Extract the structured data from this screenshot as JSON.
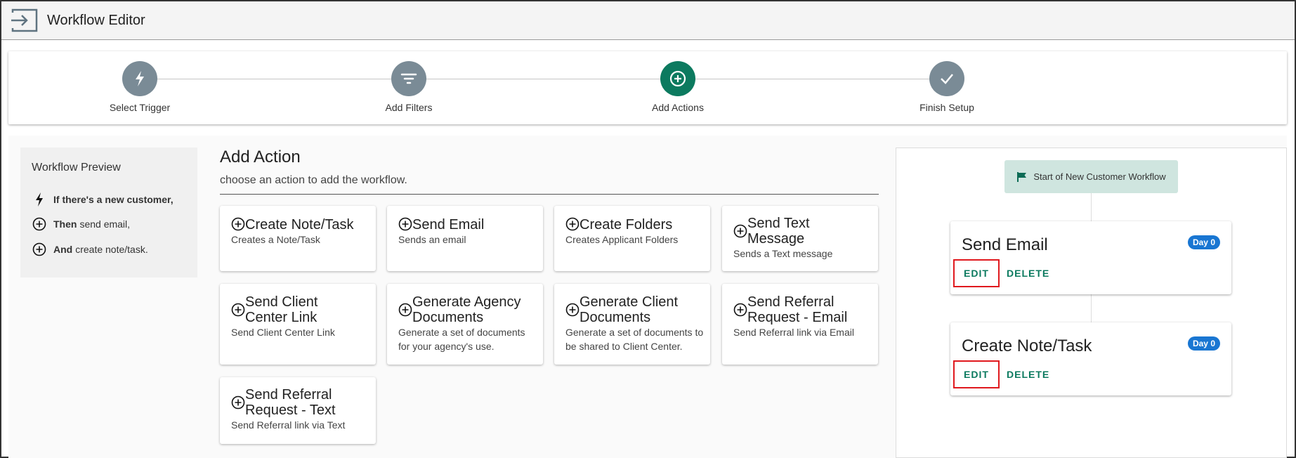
{
  "app": {
    "title": "Workflow Editor"
  },
  "stepper": {
    "steps": [
      {
        "label": "Select Trigger",
        "icon": "bolt-icon",
        "active": false
      },
      {
        "label": "Add Filters",
        "icon": "filter-icon",
        "active": false
      },
      {
        "label": "Add Actions",
        "icon": "add-circle-icon",
        "active": true
      },
      {
        "label": "Finish Setup",
        "icon": "check-icon",
        "active": false
      }
    ]
  },
  "preview": {
    "title": "Workflow Preview",
    "rows": [
      {
        "icon": "bolt-icon",
        "bold": "If there's a new customer,",
        "text": ""
      },
      {
        "icon": "add-circle-icon",
        "bold": "Then",
        "text": "send email,"
      },
      {
        "icon": "add-circle-icon",
        "bold": "And",
        "text": "create note/task."
      }
    ]
  },
  "add_action": {
    "title": "Add Action",
    "subtitle": "choose an action to add the workflow.",
    "cards": [
      {
        "title": "Create Note/Task",
        "desc": "Creates a Note/Task"
      },
      {
        "title": "Send Email",
        "desc": "Sends an email"
      },
      {
        "title": "Create Folders",
        "desc": "Creates Applicant Folders"
      },
      {
        "title": "Send Text Message",
        "desc": "Sends a Text message"
      },
      {
        "title": "Send Client Center Link",
        "desc": "Send Client Center Link"
      },
      {
        "title": "Generate Agency Documents",
        "desc": "Generate a set of documents for your agency's use."
      },
      {
        "title": "Generate Client Documents",
        "desc": "Generate a set of documents to be shared to Client Center."
      },
      {
        "title": "Send Referral Request - Email",
        "desc": "Send Referral link via Email"
      },
      {
        "title": "Send Referral Request - Text",
        "desc": "Send Referral link via Text"
      }
    ]
  },
  "workflow": {
    "start_label": "Start of New Customer Workflow",
    "steps": [
      {
        "title": "Send Email",
        "badge": "Day 0",
        "edit": "EDIT",
        "delete": "DELETE"
      },
      {
        "title": "Create Note/Task",
        "badge": "Day 0",
        "edit": "EDIT",
        "delete": "DELETE"
      }
    ]
  },
  "colors": {
    "accent": "#0c7a5f",
    "step_inactive": "#7a8b96",
    "badge": "#1976d2",
    "highlight": "#e0191e",
    "chip": "#cfe5df"
  }
}
